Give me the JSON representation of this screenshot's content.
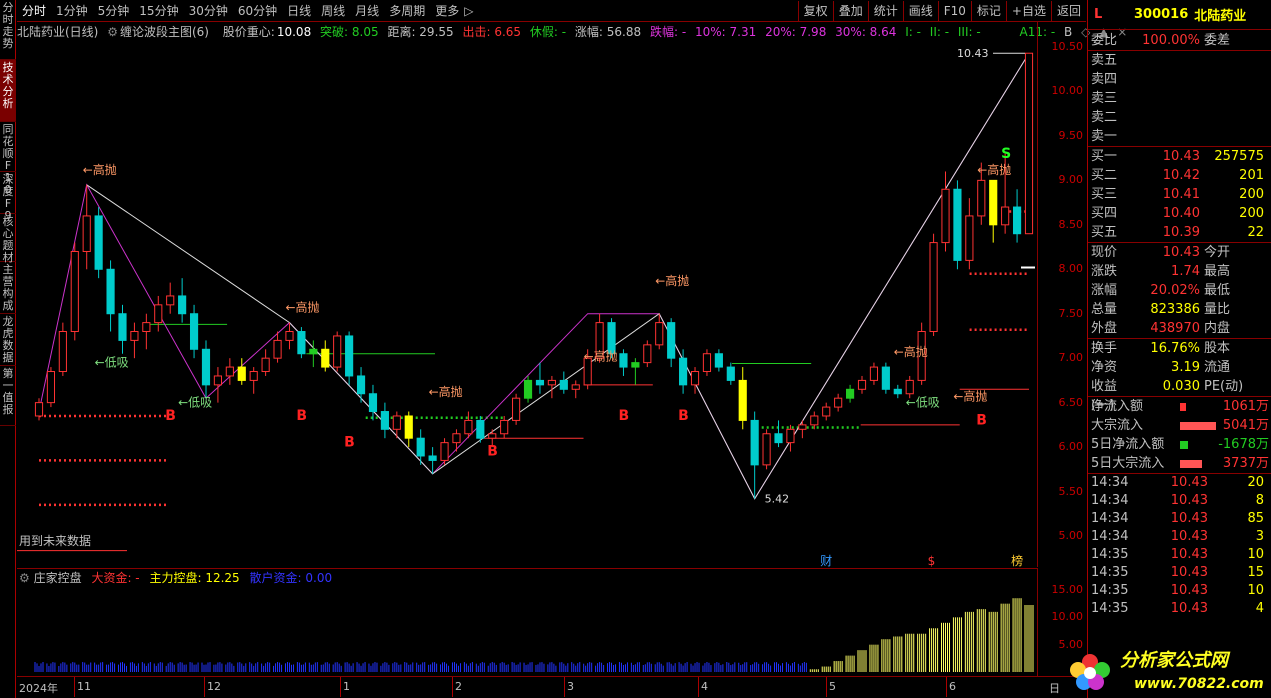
{
  "left_tabs": [
    "分时走势",
    "技术分析",
    "同花顺F10",
    "深度F9",
    "核心题材",
    "主营构成",
    "龙虎数据",
    "第一值报"
  ],
  "toolbar": {
    "periods": [
      "分时",
      "1分钟",
      "5分钟",
      "15分钟",
      "30分钟",
      "60分钟",
      "日线",
      "周线",
      "月线",
      "多周期",
      "更多"
    ],
    "more_arrow": "▷",
    "buttons": [
      "复权",
      "叠加",
      "统计",
      "画线",
      "F10",
      "标记",
      "+自选",
      "返回"
    ]
  },
  "header": {
    "stock_label": "北陆药业(日线)",
    "indicator": "缠论波段主图(6)",
    "center_label": "股价重心:",
    "center_value": "10.08",
    "breakout": "突破: 8.05",
    "distance": "距离: 29.55",
    "exit": "出击: 6.65",
    "rest": "休假: -",
    "rise": "涨幅: 56.88",
    "fall": "跌幅: -",
    "p10": "10%: 7.31",
    "p20": "20%: 7.98",
    "p30": "30%: 8.64",
    "lvl1": "I: -",
    "lvl2": "II: -",
    "lvl3": "III: -",
    "a11": "A11: -",
    "b": "B"
  },
  "chart_labels": {
    "high_sell": "高抛",
    "low_buy": "低吸",
    "buy_mark": "B",
    "sell_mark": "S",
    "high_value": "10.43",
    "low_value": "5.42",
    "future_data": "用到未来数据",
    "events": [
      "财",
      "$",
      "榜"
    ]
  },
  "price_axis": [
    "10.50",
    "10.00",
    "9.50",
    "9.00",
    "8.50",
    "8.00",
    "7.50",
    "7.00",
    "6.50",
    "6.00",
    "5.50",
    "5.00"
  ],
  "indicator": {
    "name": "庄家控盘",
    "big_fund": "大资金: -",
    "main_control": "主力控盘: 12.25",
    "retail": "散户资金: 0.00",
    "axis": [
      "15.00",
      "10.00",
      "5.00"
    ]
  },
  "date_axis": [
    "2024年",
    "11",
    "12",
    "1",
    "2",
    "3",
    "4",
    "5",
    "6"
  ],
  "date_corner": "日",
  "quote": {
    "flag": "L",
    "code": "300016",
    "name": "北陆药业",
    "webi_label": "委比",
    "webi_value": "100.00%",
    "weicha_label": "委差",
    "asks": [
      {
        "label": "卖五",
        "price": "",
        "vol": ""
      },
      {
        "label": "卖四",
        "price": "",
        "vol": ""
      },
      {
        "label": "卖三",
        "price": "",
        "vol": ""
      },
      {
        "label": "卖二",
        "price": "",
        "vol": ""
      },
      {
        "label": "卖一",
        "price": "",
        "vol": ""
      }
    ],
    "bids": [
      {
        "label": "买一",
        "price": "10.43",
        "vol": "257575"
      },
      {
        "label": "买二",
        "price": "10.42",
        "vol": "201"
      },
      {
        "label": "买三",
        "price": "10.41",
        "vol": "200"
      },
      {
        "label": "买四",
        "price": "10.40",
        "vol": "200"
      },
      {
        "label": "买五",
        "price": "10.39",
        "vol": "22"
      }
    ],
    "stats": [
      {
        "l1": "现价",
        "v1": "10.43",
        "l2": "今开",
        "c": "#f33"
      },
      {
        "l1": "涨跌",
        "v1": "1.74",
        "l2": "最高",
        "c": "#f33"
      },
      {
        "l1": "涨幅",
        "v1": "20.02%",
        "l2": "最低",
        "c": "#f33"
      },
      {
        "l1": "总量",
        "v1": "823386",
        "l2": "量比",
        "c": "#ff0"
      },
      {
        "l1": "外盘",
        "v1": "438970",
        "l2": "内盘",
        "c": "#f33"
      }
    ],
    "stats2": [
      {
        "l1": "换手",
        "v1": "16.76%",
        "l2": "股本",
        "c": "#ff0"
      },
      {
        "l1": "净资",
        "v1": "3.19",
        "l2": "流通",
        "c": "#ff0"
      },
      {
        "l1": "收益(一)",
        "v1": "0.030",
        "l2": "PE(动)",
        "c": "#ff0"
      }
    ],
    "flows": [
      {
        "label": "净流入额",
        "value": "1061万",
        "bar": "#f33",
        "bw": 6,
        "c": "#f33"
      },
      {
        "label": "大宗流入",
        "value": "5041万",
        "bar": "#f55",
        "bw": 36,
        "c": "#f33"
      },
      {
        "label": "5日净流入额",
        "value": "-1678万",
        "bar": "#2c2",
        "bw": 8,
        "c": "#2c2"
      },
      {
        "label": "5日大宗流入",
        "value": "3737万",
        "bar": "#f55",
        "bw": 22,
        "c": "#f33"
      }
    ],
    "ticks": [
      {
        "time": "14:34",
        "price": "10.43",
        "vol": "20"
      },
      {
        "time": "14:34",
        "price": "10.43",
        "vol": "8"
      },
      {
        "time": "14:34",
        "price": "10.43",
        "vol": "85"
      },
      {
        "time": "14:34",
        "price": "10.43",
        "vol": "3"
      },
      {
        "time": "14:35",
        "price": "10.43",
        "vol": "10"
      },
      {
        "time": "14:35",
        "price": "10.43",
        "vol": "15"
      },
      {
        "time": "14:35",
        "price": "10.43",
        "vol": "10"
      },
      {
        "time": "14:35",
        "price": "10.43",
        "vol": "4"
      }
    ]
  },
  "watermark": {
    "main": "分析家公式网",
    "url": "www.70822.com"
  },
  "colors": {
    "accent": "#ff0000",
    "up": "#ff3333",
    "down": "#00cccc",
    "zigzag": "#cc33cc",
    "yellow": "#ffff00",
    "green": "#22cc22"
  },
  "chart_data": {
    "type": "candlestick",
    "categories": [
      "2024年",
      "11",
      "12",
      "1",
      "2",
      "3",
      "4",
      "5",
      "6"
    ],
    "ylim": [
      4.8,
      10.6
    ],
    "annotations": {
      "high": 10.43,
      "low": 5.42
    },
    "ohlc": [
      [
        6.35,
        6.55,
        6.3,
        6.5
      ],
      [
        6.5,
        6.9,
        6.45,
        6.85
      ],
      [
        6.85,
        7.4,
        6.8,
        7.3
      ],
      [
        7.3,
        8.3,
        7.2,
        8.2
      ],
      [
        8.2,
        8.95,
        8.0,
        8.6
      ],
      [
        8.6,
        8.7,
        7.9,
        8.0
      ],
      [
        8.0,
        8.1,
        7.3,
        7.5
      ],
      [
        7.5,
        7.6,
        7.05,
        7.2
      ],
      [
        7.2,
        7.4,
        7.0,
        7.3
      ],
      [
        7.3,
        7.5,
        7.1,
        7.4
      ],
      [
        7.4,
        7.7,
        7.3,
        7.6
      ],
      [
        7.6,
        7.85,
        7.5,
        7.7
      ],
      [
        7.7,
        7.9,
        7.4,
        7.5
      ],
      [
        7.5,
        7.6,
        7.0,
        7.1
      ],
      [
        7.1,
        7.2,
        6.55,
        6.7
      ],
      [
        6.7,
        6.9,
        6.5,
        6.8
      ],
      [
        6.8,
        7.0,
        6.7,
        6.9
      ],
      [
        6.9,
        7.0,
        6.7,
        6.75
      ],
      [
        6.75,
        6.9,
        6.6,
        6.85
      ],
      [
        6.85,
        7.1,
        6.8,
        7.0
      ],
      [
        7.0,
        7.3,
        6.95,
        7.2
      ],
      [
        7.2,
        7.4,
        7.1,
        7.3
      ],
      [
        7.3,
        7.35,
        7.0,
        7.05
      ],
      [
        7.05,
        7.2,
        6.9,
        7.1
      ],
      [
        7.1,
        7.2,
        6.85,
        6.9
      ],
      [
        6.9,
        7.3,
        6.85,
        7.25
      ],
      [
        7.25,
        7.3,
        6.7,
        6.8
      ],
      [
        6.8,
        6.9,
        6.5,
        6.6
      ],
      [
        6.6,
        6.7,
        6.3,
        6.4
      ],
      [
        6.4,
        6.5,
        6.1,
        6.2
      ],
      [
        6.2,
        6.4,
        6.1,
        6.35
      ],
      [
        6.35,
        6.4,
        6.0,
        6.1
      ],
      [
        6.1,
        6.2,
        5.8,
        5.9
      ],
      [
        5.9,
        6.0,
        5.7,
        5.85
      ],
      [
        5.85,
        6.1,
        5.8,
        6.05
      ],
      [
        6.05,
        6.2,
        5.95,
        6.15
      ],
      [
        6.15,
        6.4,
        6.1,
        6.3
      ],
      [
        6.3,
        6.35,
        6.05,
        6.1
      ],
      [
        6.1,
        6.2,
        6.0,
        6.15
      ],
      [
        6.15,
        6.35,
        6.1,
        6.3
      ],
      [
        6.3,
        6.6,
        6.25,
        6.55
      ],
      [
        6.55,
        6.8,
        6.5,
        6.75
      ],
      [
        6.75,
        6.95,
        6.6,
        6.7
      ],
      [
        6.7,
        6.8,
        6.55,
        6.75
      ],
      [
        6.75,
        6.85,
        6.6,
        6.65
      ],
      [
        6.65,
        6.75,
        6.55,
        6.7
      ],
      [
        6.7,
        7.1,
        6.65,
        7.0
      ],
      [
        7.0,
        7.5,
        6.95,
        7.4
      ],
      [
        7.4,
        7.45,
        7.0,
        7.05
      ],
      [
        7.05,
        7.1,
        6.8,
        6.9
      ],
      [
        6.9,
        7.0,
        6.7,
        6.95
      ],
      [
        6.95,
        7.2,
        6.9,
        7.15
      ],
      [
        7.15,
        7.5,
        7.1,
        7.4
      ],
      [
        7.4,
        7.45,
        6.9,
        7.0
      ],
      [
        7.0,
        7.1,
        6.6,
        6.7
      ],
      [
        6.7,
        6.9,
        6.6,
        6.85
      ],
      [
        6.85,
        7.1,
        6.8,
        7.05
      ],
      [
        7.05,
        7.1,
        6.85,
        6.9
      ],
      [
        6.9,
        6.95,
        6.7,
        6.75
      ],
      [
        6.75,
        6.9,
        6.2,
        6.3
      ],
      [
        6.3,
        6.4,
        5.42,
        5.8
      ],
      [
        5.8,
        6.2,
        5.75,
        6.15
      ],
      [
        6.15,
        6.3,
        6.0,
        6.05
      ],
      [
        6.05,
        6.25,
        5.95,
        6.2
      ],
      [
        6.2,
        6.3,
        6.1,
        6.25
      ],
      [
        6.25,
        6.4,
        6.2,
        6.35
      ],
      [
        6.35,
        6.5,
        6.3,
        6.45
      ],
      [
        6.45,
        6.6,
        6.4,
        6.55
      ],
      [
        6.55,
        6.7,
        6.5,
        6.65
      ],
      [
        6.65,
        6.8,
        6.6,
        6.75
      ],
      [
        6.75,
        6.95,
        6.7,
        6.9
      ],
      [
        6.9,
        6.95,
        6.6,
        6.65
      ],
      [
        6.65,
        6.7,
        6.55,
        6.6
      ],
      [
        6.6,
        6.8,
        6.55,
        6.75
      ],
      [
        6.75,
        7.4,
        6.7,
        7.3
      ],
      [
        7.3,
        8.4,
        7.25,
        8.3
      ],
      [
        8.3,
        9.1,
        8.2,
        8.9
      ],
      [
        8.9,
        9.0,
        8.0,
        8.1
      ],
      [
        8.1,
        8.8,
        8.0,
        8.6
      ],
      [
        8.6,
        9.2,
        8.5,
        9.0
      ],
      [
        9.0,
        9.0,
        8.3,
        8.5
      ],
      [
        8.5,
        9.3,
        8.4,
        8.7
      ],
      [
        8.7,
        8.9,
        8.3,
        8.4
      ],
      [
        8.4,
        10.43,
        8.4,
        10.43
      ]
    ],
    "indicator_series": {
      "name": "主力控盘",
      "values": [
        0,
        0,
        0,
        0,
        0,
        0,
        0,
        0,
        0,
        0,
        0,
        0,
        0,
        0,
        0,
        0,
        0,
        0,
        0,
        0,
        0,
        0,
        0,
        0,
        0,
        0,
        0,
        0,
        0,
        0,
        0,
        0,
        0,
        0,
        0,
        0,
        0,
        0,
        0,
        0,
        0,
        0,
        0,
        0,
        0,
        0,
        0,
        0,
        0,
        0,
        0,
        0,
        0,
        0,
        0,
        0,
        0,
        0,
        0,
        0,
        0,
        0,
        0,
        0,
        0,
        0.5,
        1,
        2,
        3,
        4,
        5,
        6,
        6.5,
        7,
        7,
        8,
        9,
        10,
        11,
        11.5,
        11,
        12.5,
        13.5,
        12.25
      ]
    },
    "retail_series": [
      1,
      1,
      1,
      1,
      1,
      1,
      1,
      1,
      1,
      1,
      1,
      1,
      1,
      1,
      1,
      1,
      1,
      1,
      1,
      1,
      1,
      1,
      1,
      1,
      1,
      1,
      1,
      1,
      1,
      1,
      1,
      1,
      1,
      1,
      1,
      1,
      1,
      1,
      1,
      1,
      1,
      1,
      1,
      1,
      1,
      1,
      1,
      1,
      1,
      1,
      1,
      1,
      1,
      1,
      1,
      1,
      1,
      1,
      1,
      1,
      1,
      1,
      1,
      1,
      1,
      0,
      0,
      0,
      0,
      0,
      0,
      0,
      0,
      0,
      0,
      0,
      0,
      0,
      0,
      0,
      0,
      0,
      0,
      0
    ]
  }
}
